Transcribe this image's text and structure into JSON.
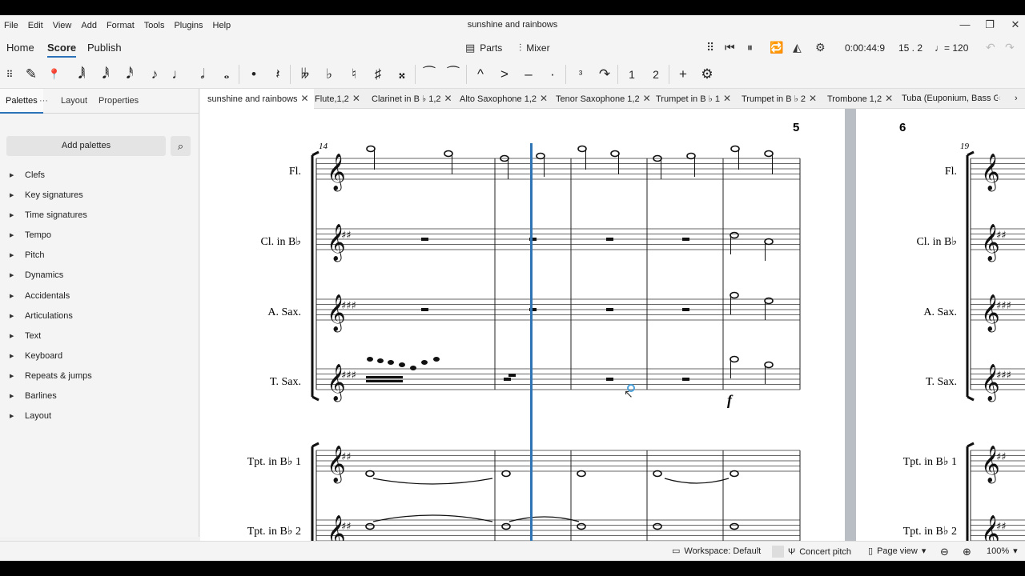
{
  "window": {
    "title": "sunshine and rainbows",
    "controls": [
      "—",
      "❐",
      "✕"
    ]
  },
  "menu": [
    "File",
    "Edit",
    "View",
    "Add",
    "Format",
    "Tools",
    "Plugins",
    "Help"
  ],
  "nav": {
    "tabs": [
      "Home",
      "Score",
      "Publish"
    ],
    "parts_label": "Parts",
    "mixer_label": "Mixer",
    "time": "0:00:44:9",
    "position": "15 . 2",
    "tempo": "= 120"
  },
  "toolbar": {
    "items": [
      "✎",
      "📍",
      "𝅘𝅥𝅲",
      "𝅘𝅥𝅱",
      "𝅘𝅥𝅰",
      "♪",
      "♩",
      "𝅗𝅥",
      "𝅝",
      "•",
      "𝄽",
      "𝄫",
      "♭",
      "♮",
      "♯",
      "𝄪",
      "⁀",
      "⁀",
      "^",
      ">",
      "–",
      "·",
      "³",
      "↷",
      "1",
      "2",
      "+",
      "⚙"
    ]
  },
  "panel": {
    "tabs": [
      "Palettes",
      "Layout",
      "Properties"
    ],
    "more": "···",
    "add_palettes": "Add palettes",
    "palettes": [
      "Clefs",
      "Key signatures",
      "Time signatures",
      "Tempo",
      "Pitch",
      "Dynamics",
      "Accidentals",
      "Articulations",
      "Text",
      "Keyboard",
      "Repeats & jumps",
      "Barlines",
      "Layout"
    ]
  },
  "score_tabs": [
    "sunshine and rainbows",
    "Flute,1,2",
    "Clarinet in B ♭ 1,2",
    "Alto Saxophone 1,2",
    "Tenor Saxophone 1,2",
    "Trumpet in B ♭ 1",
    "Trumpet in B ♭ 2",
    "Trombone 1,2",
    "Tuba (Euponium, Bass Gut"
  ],
  "score": {
    "measure_numbers": [
      "14",
      "19"
    ],
    "rehearsal": [
      "5",
      "6"
    ],
    "instruments": [
      "Fl.",
      "Cl. in B♭",
      "A. Sax.",
      "T. Sax.",
      "Tpt. in B♭ 1",
      "Tpt. in B♭ 2"
    ],
    "dynamic": "f"
  },
  "status": {
    "workspace": "Workspace: Default",
    "concert_pitch": "Concert pitch",
    "view": "Page view",
    "zoom": "100%"
  },
  "colors": {
    "accent": "#2c72b8",
    "playhead": "#2f75b5",
    "page_gap": "#b9bec4"
  }
}
